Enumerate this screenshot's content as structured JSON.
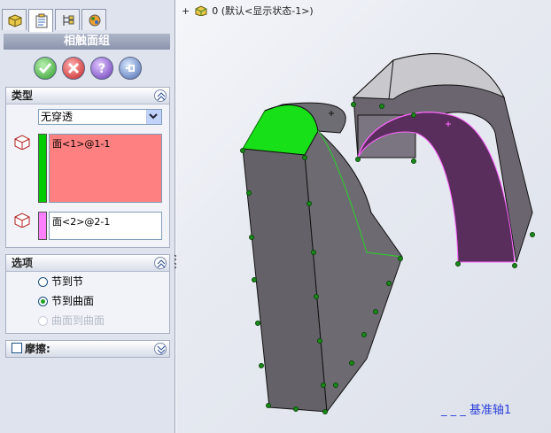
{
  "panel": {
    "title": "相触面组",
    "tabs": [
      "feature-manager-icon",
      "property-manager-icon",
      "configuration-manager-icon",
      "display-manager-icon"
    ],
    "actions": [
      "ok-icon",
      "cancel-icon",
      "help-icon",
      "pin-icon"
    ],
    "type_group": {
      "header": "类型",
      "select_value": "无穿透",
      "selection1": "面<1>@1-1",
      "selection1_color": "#ff8080",
      "selection1_bar_color": "#00cc00",
      "selection2": "面<2>@2-1",
      "selection2_bar_color": "#ff80ff"
    },
    "options_group": {
      "header": "选项",
      "options": [
        {
          "label": "节到节",
          "selected": false,
          "enabled": true
        },
        {
          "label": "节到曲面",
          "selected": true,
          "enabled": true
        },
        {
          "label": "曲面到曲面",
          "selected": false,
          "enabled": false
        }
      ]
    },
    "friction_group": {
      "header": "摩擦:",
      "checked": false
    }
  },
  "viewport": {
    "tree_top_marker": "+",
    "tree_top_label": "0   (默认<显示状态-1>)",
    "axis_label": "基准轴1",
    "axis_dash": "_ _ _"
  }
}
